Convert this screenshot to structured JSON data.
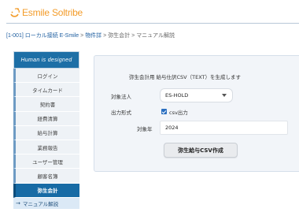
{
  "app": {
    "logo_text": "Esmile Soltribe",
    "brand_color": "#f39c2a"
  },
  "breadcrumb": {
    "items": [
      "[1-001] ローカル接続 E-Smile",
      "物件詳",
      "弥生会計",
      "マニュアル解説"
    ],
    "separator": ">"
  },
  "sidebar": {
    "banner": "Human is designed",
    "items": [
      {
        "label": "ログイン"
      },
      {
        "label": "タイムカード"
      },
      {
        "label": "契約書"
      },
      {
        "label": "経費清算"
      },
      {
        "label": "給与計算"
      },
      {
        "label": "業務報告"
      },
      {
        "label": "ユーザー管理"
      },
      {
        "label": "顧客名簿"
      },
      {
        "label": "弥生会計",
        "active": true
      }
    ],
    "sub_item": {
      "arrow": "→",
      "label": "マニュアル解説"
    }
  },
  "form": {
    "title": "弥生会計用 給与仕訳CSV（TEXT）を生成します",
    "corp_label": "対象法人",
    "corp_value": "ES-HOLD",
    "format_label": "出力形式",
    "format_checked": true,
    "format_option": "csv出力",
    "year_label": "対象年",
    "year_value": "2024",
    "submit_label": "弥生給与CSV作成"
  },
  "colors": {
    "sidebar_active": "#176ba5",
    "sidebar_banner": "#1d6fa6",
    "link": "#1f5fa0",
    "panel_bg": "#f2f5f9"
  }
}
